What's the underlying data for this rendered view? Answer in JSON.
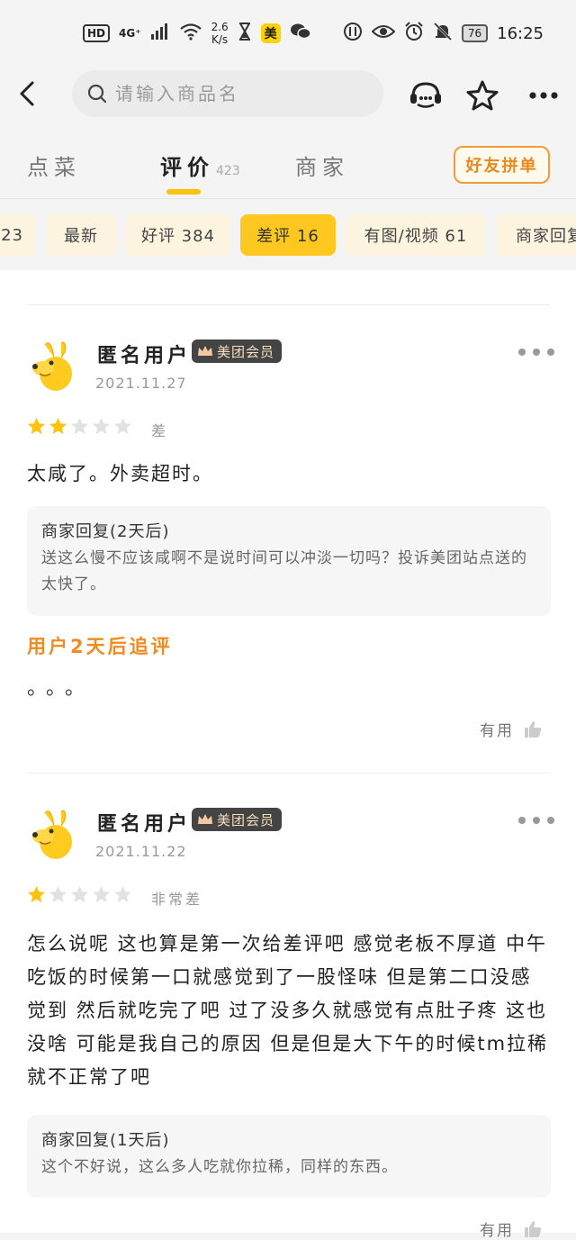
{
  "status_bar": {
    "hd": "HD",
    "network": "4G⁺",
    "speed_value": "2.6",
    "speed_unit": "K/s",
    "app_badge": "美",
    "battery": "76",
    "time": "16:25"
  },
  "topbar": {
    "search_placeholder": "请输入商品名"
  },
  "tabs": [
    {
      "label": "点菜"
    },
    {
      "label": "评价",
      "count": "423"
    },
    {
      "label": "商家"
    }
  ],
  "group_button_label": "好友拼单",
  "filters": [
    {
      "label": "23"
    },
    {
      "label": "最新"
    },
    {
      "label": "好评 384"
    },
    {
      "label": "差评 16"
    },
    {
      "label": "有图/视频 61"
    },
    {
      "label": "商家回复"
    }
  ],
  "reviews": [
    {
      "username": "匿名用户",
      "badge": "美团会员",
      "date": "2021.11.27",
      "stars": 2,
      "rating_text": "差",
      "content": "太咸了。外卖超时。",
      "reply_title": "商家回复(2天后)",
      "reply_text": "送这么慢不应该咸啊不是说时间可以冲淡一切吗？投诉美团站点送的太快了。",
      "follow_title": "用户2天后追评",
      "follow_text": "。。。",
      "useful_label": "有用"
    },
    {
      "username": "匿名用户",
      "badge": "美团会员",
      "date": "2021.11.22",
      "stars": 1,
      "rating_text": "非常差",
      "content": "怎么说呢 这也算是第一次给差评吧 感觉老板不厚道 中午吃饭的时候第一口就感觉到了一股怪味 但是第二口没感觉到 然后就吃完了吧 过了没多久就感觉有点肚子疼 这也没啥 可能是我自己的原因 但是但是大下午的时候tm拉稀就不正常了吧",
      "reply_title": "商家回复(1天后)",
      "reply_text": "这个不好说，这么多人吃就你拉稀，同样的东西。",
      "useful_label": "有用"
    }
  ],
  "colors": {
    "accent_yellow": "#ffc821",
    "chip_bg": "#fdf4e0",
    "orange_text": "#ef8b1f",
    "star_on": "#ffc20e",
    "star_off": "#e2e2e2"
  }
}
